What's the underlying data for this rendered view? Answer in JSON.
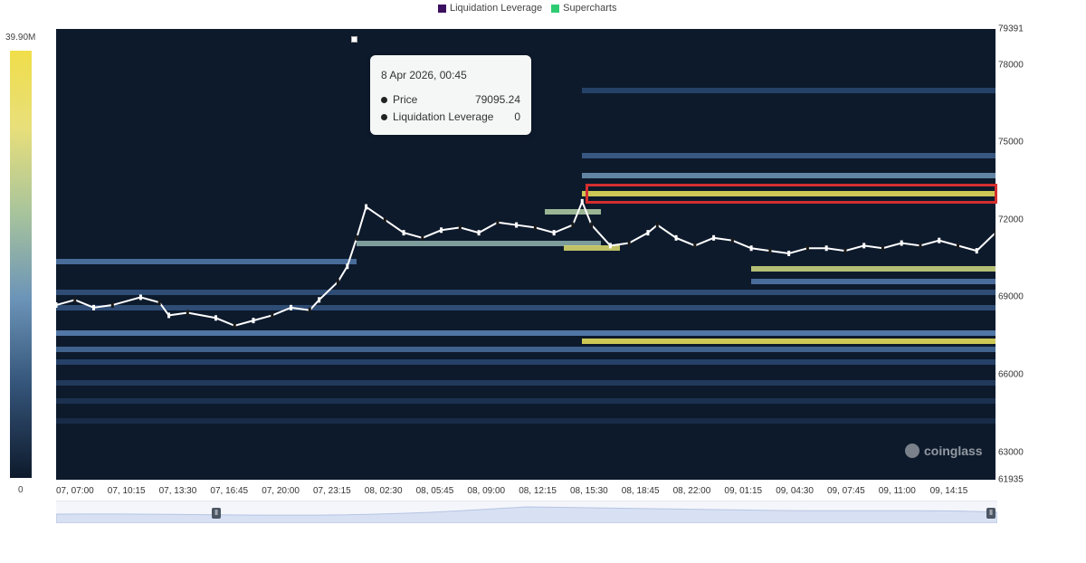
{
  "legend": {
    "items": [
      {
        "label": "Liquidation Leverage",
        "color": "#3b1060"
      },
      {
        "label": "Supercharts",
        "color": "#2ecc71"
      }
    ]
  },
  "colorbar": {
    "max_label": "39.90M",
    "min_label": "0"
  },
  "tooltip": {
    "title": "8 Apr 2026, 00:45",
    "rows": [
      {
        "label": "Price",
        "value": "79095.24"
      },
      {
        "label": "Liquidation Leverage",
        "value": "0"
      }
    ]
  },
  "watermark": {
    "text": "coinglass"
  },
  "chart_data": {
    "type": "heatmap",
    "title": "",
    "xlabel": "",
    "ylabel": "",
    "ylim": [
      61935,
      79391
    ],
    "y_ticks": [
      "79391",
      "78000",
      "75000",
      "72000",
      "69000",
      "66000",
      "63000",
      "61935"
    ],
    "x_ticks": [
      "07, 07:00",
      "07, 10:15",
      "07, 13:30",
      "07, 16:45",
      "07, 20:00",
      "07, 23:15",
      "08, 02:30",
      "08, 05:45",
      "08, 09:00",
      "08, 12:15",
      "08, 15:30",
      "08, 18:45",
      "08, 22:00",
      "09, 01:15",
      "09, 04:30",
      "09, 07:45",
      "09, 11:00",
      "09, 14:15"
    ],
    "color_scale": {
      "min": 0,
      "max": 39900000,
      "max_label": "39.90M"
    },
    "liquidation_bands": [
      {
        "price": 77000,
        "x_from": 0.56,
        "x_to": 1.0,
        "intensity": 0.25
      },
      {
        "price": 74500,
        "x_from": 0.56,
        "x_to": 1.0,
        "intensity": 0.35
      },
      {
        "price": 73700,
        "x_from": 0.56,
        "x_to": 1.0,
        "intensity": 0.55
      },
      {
        "price": 73000,
        "x_from": 0.56,
        "x_to": 1.0,
        "intensity": 0.95
      },
      {
        "price": 72300,
        "x_from": 0.52,
        "x_to": 0.58,
        "intensity": 0.75
      },
      {
        "price": 71100,
        "x_from": 0.32,
        "x_to": 0.58,
        "intensity": 0.65
      },
      {
        "price": 70900,
        "x_from": 0.54,
        "x_to": 0.6,
        "intensity": 0.9
      },
      {
        "price": 70400,
        "x_from": 0.0,
        "x_to": 0.32,
        "intensity": 0.45
      },
      {
        "price": 70100,
        "x_from": 0.74,
        "x_to": 1.0,
        "intensity": 0.85
      },
      {
        "price": 69600,
        "x_from": 0.74,
        "x_to": 1.0,
        "intensity": 0.45
      },
      {
        "price": 69200,
        "x_from": 0.0,
        "x_to": 1.0,
        "intensity": 0.3
      },
      {
        "price": 68600,
        "x_from": 0.0,
        "x_to": 1.0,
        "intensity": 0.3
      },
      {
        "price": 67600,
        "x_from": 0.0,
        "x_to": 1.0,
        "intensity": 0.5
      },
      {
        "price": 67300,
        "x_from": 0.56,
        "x_to": 1.0,
        "intensity": 0.95
      },
      {
        "price": 67000,
        "x_from": 0.0,
        "x_to": 1.0,
        "intensity": 0.4
      },
      {
        "price": 66500,
        "x_from": 0.0,
        "x_to": 1.0,
        "intensity": 0.25
      },
      {
        "price": 65700,
        "x_from": 0.0,
        "x_to": 1.0,
        "intensity": 0.2
      },
      {
        "price": 65000,
        "x_from": 0.0,
        "x_to": 1.0,
        "intensity": 0.15
      },
      {
        "price": 64200,
        "x_from": 0.0,
        "x_to": 1.0,
        "intensity": 0.12
      }
    ],
    "price_series": [
      [
        0.0,
        68700
      ],
      [
        0.02,
        68900
      ],
      [
        0.04,
        68600
      ],
      [
        0.06,
        68700
      ],
      [
        0.09,
        69000
      ],
      [
        0.11,
        68800
      ],
      [
        0.12,
        68300
      ],
      [
        0.14,
        68400
      ],
      [
        0.17,
        68200
      ],
      [
        0.19,
        67900
      ],
      [
        0.21,
        68100
      ],
      [
        0.23,
        68300
      ],
      [
        0.25,
        68600
      ],
      [
        0.27,
        68500
      ],
      [
        0.28,
        68900
      ],
      [
        0.3,
        69600
      ],
      [
        0.31,
        70200
      ],
      [
        0.32,
        71300
      ],
      [
        0.33,
        72500
      ],
      [
        0.35,
        72000
      ],
      [
        0.37,
        71500
      ],
      [
        0.39,
        71300
      ],
      [
        0.41,
        71600
      ],
      [
        0.43,
        71700
      ],
      [
        0.45,
        71500
      ],
      [
        0.47,
        71900
      ],
      [
        0.49,
        71800
      ],
      [
        0.51,
        71700
      ],
      [
        0.53,
        71500
      ],
      [
        0.55,
        71800
      ],
      [
        0.56,
        72700
      ],
      [
        0.57,
        71800
      ],
      [
        0.59,
        71000
      ],
      [
        0.61,
        71100
      ],
      [
        0.63,
        71500
      ],
      [
        0.64,
        71800
      ],
      [
        0.66,
        71300
      ],
      [
        0.68,
        71000
      ],
      [
        0.7,
        71300
      ],
      [
        0.72,
        71200
      ],
      [
        0.74,
        70900
      ],
      [
        0.76,
        70800
      ],
      [
        0.78,
        70700
      ],
      [
        0.8,
        70900
      ],
      [
        0.82,
        70900
      ],
      [
        0.84,
        70800
      ],
      [
        0.86,
        71000
      ],
      [
        0.88,
        70900
      ],
      [
        0.9,
        71100
      ],
      [
        0.92,
        71000
      ],
      [
        0.94,
        71200
      ],
      [
        0.96,
        71000
      ],
      [
        0.98,
        70800
      ],
      [
        1.0,
        71500
      ]
    ]
  }
}
